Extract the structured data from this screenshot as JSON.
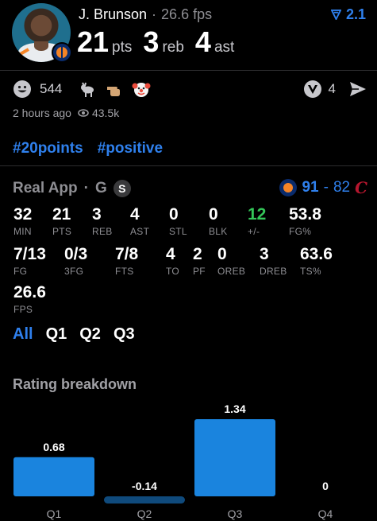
{
  "player": {
    "name": "J. Brunson",
    "separator": "·",
    "fps": "26.6 fps",
    "rank": "2.1",
    "pts": "21",
    "pts_label": "pts",
    "reb": "3",
    "reb_label": "reb",
    "ast": "4",
    "ast_label": "ast"
  },
  "reactions": {
    "smile_count": "544",
    "comment_count": "4",
    "icons": [
      "smile-icon",
      "goat-icon",
      "pointing-hand-icon",
      "clown-icon"
    ]
  },
  "meta": {
    "time": "2 hours ago",
    "views": "43.5k"
  },
  "hashtags": [
    "#20points",
    "#positive"
  ],
  "game": {
    "source": "Real App",
    "dot": "·",
    "position": "G",
    "badge": "S",
    "own_score": "91",
    "dash": "-",
    "opp_score": "82",
    "opp_logo_text": "C"
  },
  "boxscore": [
    {
      "value": "32",
      "label": "MIN"
    },
    {
      "value": "21",
      "label": "PTS"
    },
    {
      "value": "3",
      "label": "REB"
    },
    {
      "value": "4",
      "label": "AST"
    },
    {
      "value": "0",
      "label": "STL"
    },
    {
      "value": "0",
      "label": "BLK"
    },
    {
      "value": "12",
      "label": "+/-",
      "color": "#34c759"
    },
    {
      "value": "53.8",
      "label": "FG%"
    },
    {
      "value": "7/13",
      "label": "FG"
    },
    {
      "value": "0/3",
      "label": "3FG"
    },
    {
      "value": "7/8",
      "label": "FTS"
    },
    {
      "value": "4",
      "label": "TO"
    },
    {
      "value": "2",
      "label": "PF"
    },
    {
      "value": "0",
      "label": "OREB"
    },
    {
      "value": "3",
      "label": "DREB"
    },
    {
      "value": "63.6",
      "label": "TS%"
    },
    {
      "value": "26.6",
      "label": "FPS"
    }
  ],
  "tabs": [
    "All",
    "Q1",
    "Q2",
    "Q3"
  ],
  "active_tab": "All",
  "section_title": "Rating breakdown",
  "chart_data": {
    "type": "bar",
    "categories": [
      "Q1",
      "Q2",
      "Q3",
      "Q4"
    ],
    "values": [
      0.68,
      -0.14,
      1.34,
      0
    ],
    "value_labels": [
      "0.68",
      "-0.14",
      "1.34",
      "0"
    ],
    "title": "Rating breakdown",
    "xlabel": "",
    "ylabel": "",
    "colors": {
      "positive": "#1a84de",
      "negative": "#0f4a7c"
    }
  },
  "colors": {
    "accent": "#2f80ed",
    "positive": "#34c759",
    "background": "#000000"
  }
}
